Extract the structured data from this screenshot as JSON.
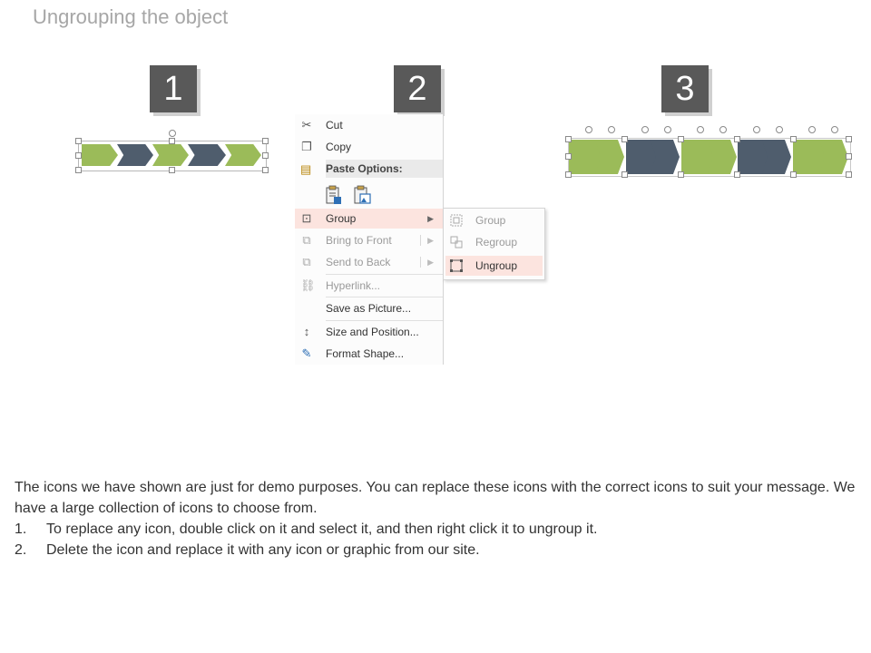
{
  "page": {
    "title": "Ungrouping the object",
    "steps": [
      "1",
      "2",
      "3"
    ]
  },
  "menu": {
    "items": [
      {
        "label": "Cut",
        "icon": "scissors-icon",
        "enabled": true
      },
      {
        "label": "Copy",
        "icon": "copy-icon",
        "enabled": true
      },
      {
        "label": "Paste Options:",
        "icon": "paste-icon",
        "enabled": true
      },
      {
        "label": "Group",
        "icon": "group-icon",
        "enabled": true,
        "submenu": true
      },
      {
        "label": "Bring to Front",
        "icon": "bring-to-front-icon",
        "enabled": false,
        "submenu": true
      },
      {
        "label": "Send to Back",
        "icon": "send-to-back-icon",
        "enabled": false,
        "submenu": true
      },
      {
        "label": "Hyperlink...",
        "icon": "hyperlink-icon",
        "enabled": false
      },
      {
        "label": "Save as Picture...",
        "icon": "",
        "enabled": true
      },
      {
        "label": "Size and Position...",
        "icon": "size-position-icon",
        "enabled": true
      },
      {
        "label": "Format Shape...",
        "icon": "format-shape-icon",
        "enabled": true
      }
    ]
  },
  "submenu": {
    "items": [
      {
        "label": "Group",
        "icon": "group-icon",
        "enabled": false
      },
      {
        "label": "Regroup",
        "icon": "regroup-icon",
        "enabled": false
      },
      {
        "label": "Ungroup",
        "icon": "ungroup-icon",
        "enabled": true
      }
    ]
  },
  "description": {
    "intro": "The icons we have shown are just for demo purposes. You can replace these icons with the correct icons to suit your message. We have a large collection of icons to choose from.",
    "steps": [
      {
        "num": "1.",
        "text": "To replace any icon, double click on it and select it, and then right click it to ungroup it."
      },
      {
        "num": "2.",
        "text": "Delete the icon and replace it with any icon or graphic from our site."
      }
    ]
  },
  "colors": {
    "green": "#9bbb59",
    "slate": "#4f5d6d",
    "highlight": "#fce4df",
    "step_box": "#595959"
  }
}
